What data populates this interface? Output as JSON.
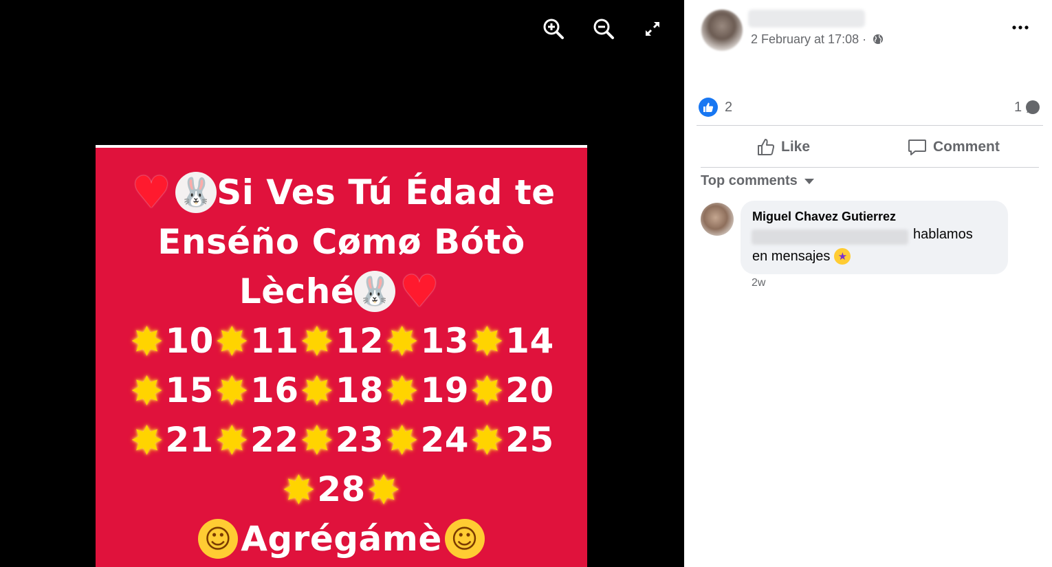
{
  "viewer": {
    "tools": {
      "zoom_in": "zoom-in-icon",
      "zoom_out": "zoom-out-icon",
      "fullscreen": "fullscreen-icon"
    },
    "photo": {
      "background": "#e0123c",
      "title_line_1": "Si Ves Tú Édad te",
      "title_line_2": "Enséño Cømø Bótò",
      "title_line_3": "Lèché",
      "number_rows": [
        [
          "10",
          "11",
          "12",
          "13",
          "14"
        ],
        [
          "15",
          "16",
          "18",
          "19",
          "20"
        ],
        [
          "21",
          "22",
          "23",
          "24",
          "25"
        ],
        [
          "28"
        ]
      ],
      "closing": "Agrégámè"
    }
  },
  "post": {
    "timestamp": "2 February at 17:08 ·",
    "more_icon": "more-dots-icon",
    "privacy_icon": "globe-icon",
    "reactions": {
      "icon": "like-thumb-icon",
      "count": "2"
    },
    "comments_count": "1",
    "actions": {
      "like": "Like",
      "comment": "Comment"
    },
    "comments_filter": "Top comments",
    "comment": {
      "author": "Miguel Chavez Gutierrez",
      "text_line_1": "hablamos",
      "text_line_2": "en mensajes",
      "emoji": "star-struck-emoji",
      "age": "2w"
    }
  },
  "colors": {
    "accent": "#1877f2",
    "secondary_text": "#65676b",
    "bubble": "#f0f2f5"
  }
}
